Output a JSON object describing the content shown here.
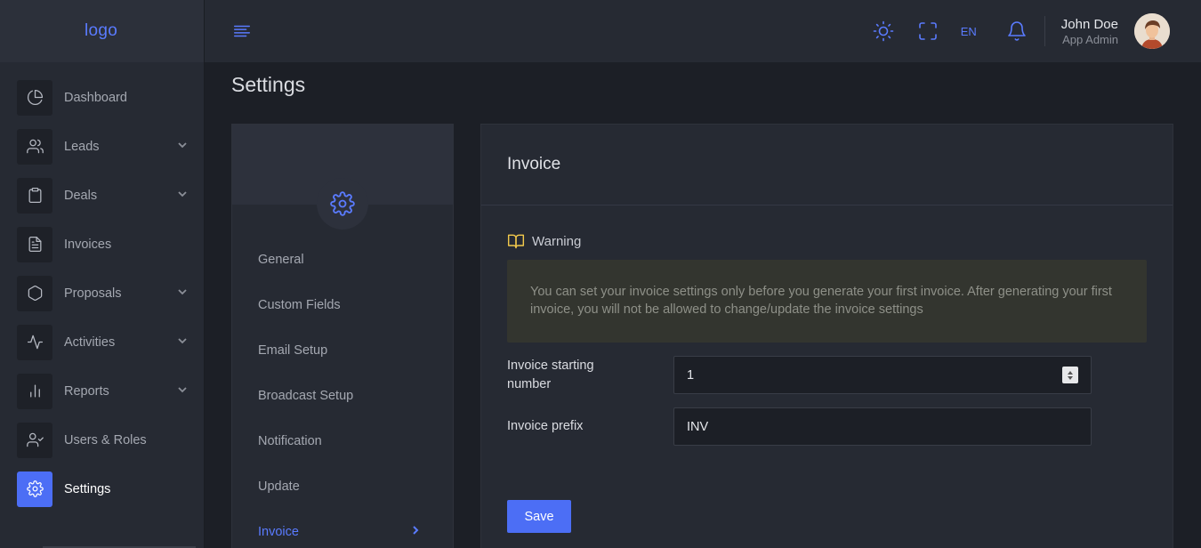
{
  "brand": {
    "logo_text": "logo"
  },
  "sidebar": {
    "items": [
      {
        "label": "Dashboard",
        "icon": "dashboard-icon",
        "has_chevron": false,
        "active": false
      },
      {
        "label": "Leads",
        "icon": "users-icon",
        "has_chevron": true,
        "active": false
      },
      {
        "label": "Deals",
        "icon": "clipboard-icon",
        "has_chevron": true,
        "active": false
      },
      {
        "label": "Invoices",
        "icon": "file-text-icon",
        "has_chevron": false,
        "active": false
      },
      {
        "label": "Proposals",
        "icon": "hexagon-icon",
        "has_chevron": true,
        "active": false
      },
      {
        "label": "Activities",
        "icon": "activity-icon",
        "has_chevron": true,
        "active": false
      },
      {
        "label": "Reports",
        "icon": "bar-chart-icon",
        "has_chevron": true,
        "active": false
      },
      {
        "label": "Users & Roles",
        "icon": "user-check-icon",
        "has_chevron": false,
        "active": false
      },
      {
        "label": "Settings",
        "icon": "settings-icon",
        "has_chevron": false,
        "active": true
      }
    ]
  },
  "topbar": {
    "language": "EN",
    "user": {
      "name": "John Doe",
      "role": "App Admin"
    }
  },
  "page": {
    "title": "Settings"
  },
  "settings_menu": {
    "items": [
      {
        "label": "General",
        "active": false
      },
      {
        "label": "Custom Fields",
        "active": false
      },
      {
        "label": "Email Setup",
        "active": false
      },
      {
        "label": "Broadcast Setup",
        "active": false
      },
      {
        "label": "Notification",
        "active": false
      },
      {
        "label": "Update",
        "active": false
      },
      {
        "label": "Invoice",
        "active": true
      }
    ]
  },
  "invoice_card": {
    "title": "Invoice",
    "warning_title": "Warning",
    "warning_text": "You can set your invoice settings only before you generate your first invoice. After generating your first invoice, you will not be allowed to change/update the invoice settings",
    "fields": {
      "starting_number_label": "Invoice starting number",
      "starting_number_value": "1",
      "prefix_label": "Invoice prefix",
      "prefix_value": "INV"
    },
    "save_label": "Save"
  },
  "colors": {
    "accent": "#4c6ef5",
    "warning_icon": "#f2c94c",
    "background": "#1c1f26",
    "panel": "#262a33"
  }
}
